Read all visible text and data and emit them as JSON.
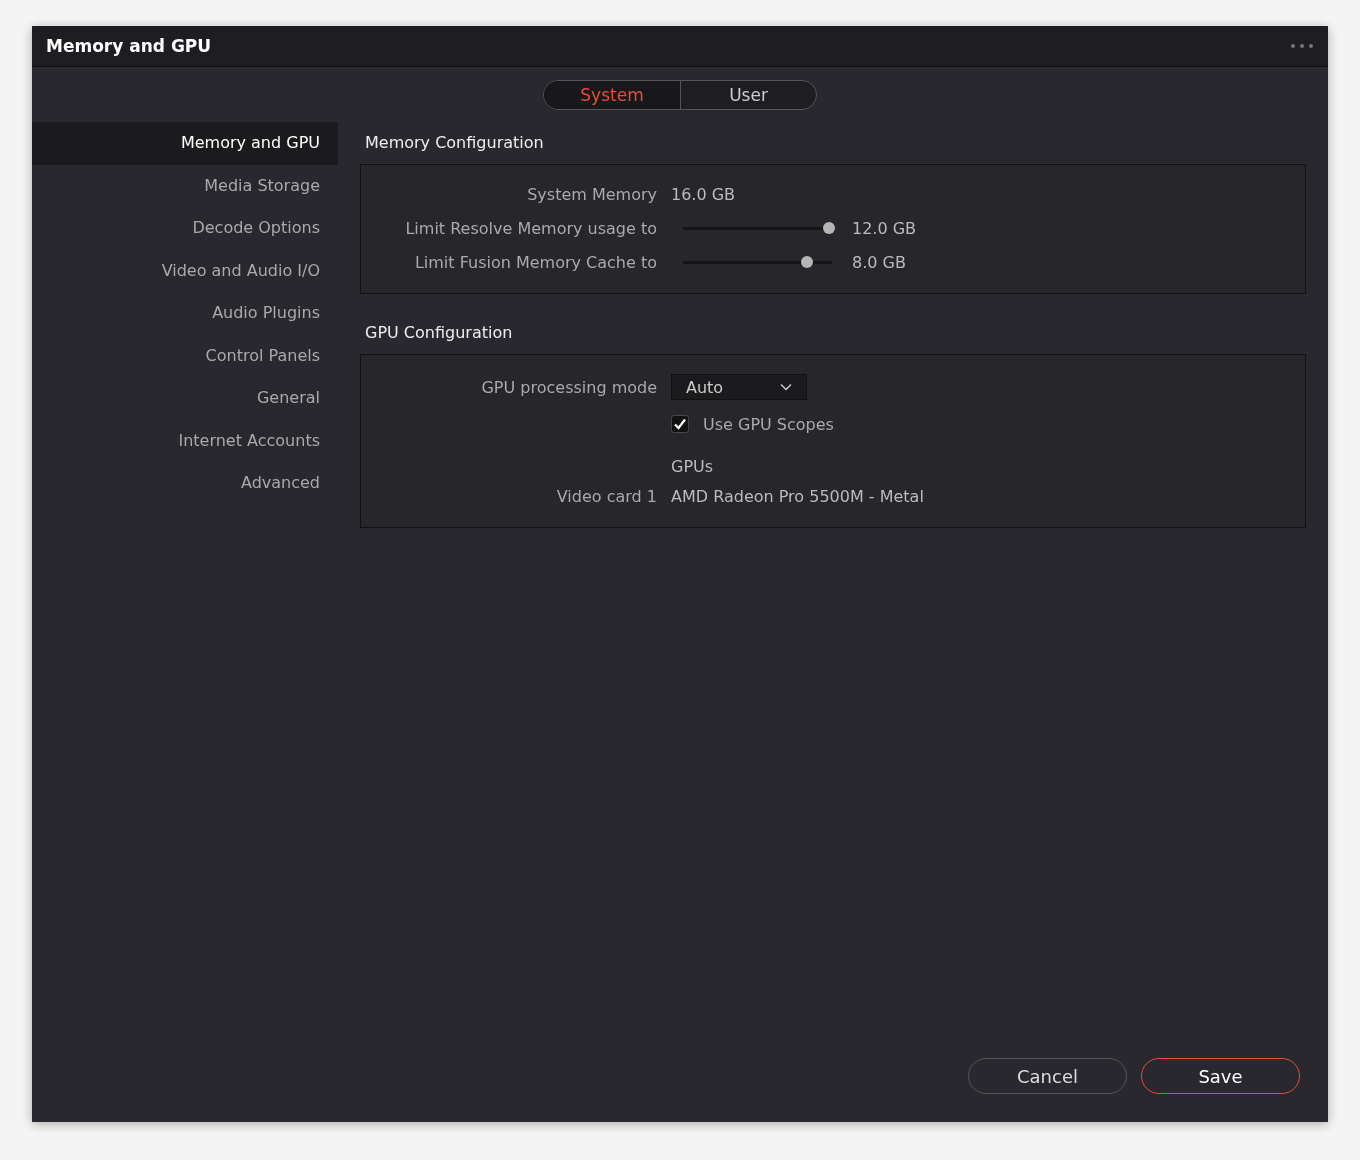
{
  "window": {
    "title": "Memory and GPU"
  },
  "tabs": [
    {
      "label": "System",
      "selected": true
    },
    {
      "label": "User",
      "selected": false
    }
  ],
  "sidebar": {
    "items": [
      {
        "label": "Memory and GPU",
        "selected": true
      },
      {
        "label": "Media Storage",
        "selected": false
      },
      {
        "label": "Decode Options",
        "selected": false
      },
      {
        "label": "Video and Audio I/O",
        "selected": false
      },
      {
        "label": "Audio Plugins",
        "selected": false
      },
      {
        "label": "Control Panels",
        "selected": false
      },
      {
        "label": "General",
        "selected": false
      },
      {
        "label": "Internet Accounts",
        "selected": false
      },
      {
        "label": "Advanced",
        "selected": false
      }
    ]
  },
  "memory_configuration": {
    "title": "Memory Configuration",
    "rows": [
      {
        "kind": "text",
        "label": "System Memory",
        "value": "16.0 GB"
      },
      {
        "kind": "slider",
        "label": "Limit Resolve Memory usage to",
        "level": 0.98,
        "value": "12.0 GB"
      },
      {
        "kind": "slider",
        "label": "Limit Fusion Memory Cache to",
        "level": 0.83,
        "value": "8.0 GB"
      }
    ]
  },
  "gpu_configuration": {
    "title": "GPU Configuration",
    "rows": [
      {
        "kind": "dropdown",
        "label": "GPU processing mode",
        "value": "Auto"
      },
      {
        "kind": "checkbox",
        "label": "Use GPU Scopes",
        "checked": true
      },
      {
        "kind": "heading",
        "value": "GPUs"
      },
      {
        "kind": "text",
        "label": "Video card 1",
        "value": "AMD Radeon Pro 5500M - Metal"
      }
    ]
  },
  "buttons": [
    {
      "label": "Cancel",
      "kind": "secondary"
    },
    {
      "label": "Save",
      "kind": "primary"
    }
  ]
}
